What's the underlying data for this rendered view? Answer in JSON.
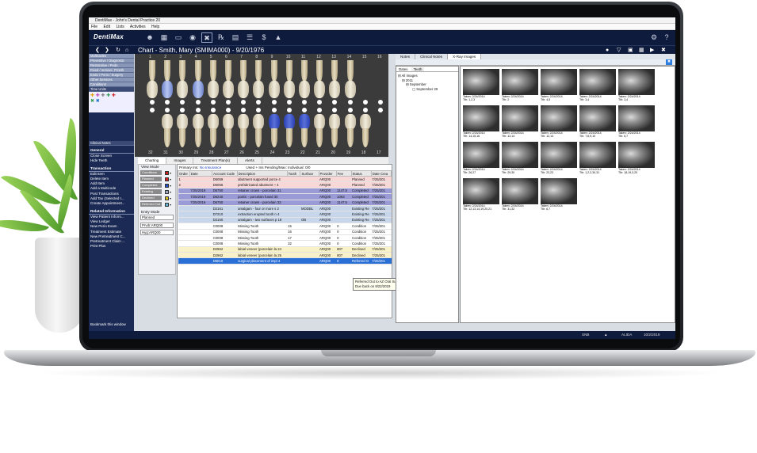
{
  "app": {
    "window_title": "DentiMax - John's Dental Practice 20",
    "logo": "DentiMax",
    "menu": [
      "File",
      "Edit",
      "Lists",
      "Activities",
      "Help"
    ],
    "chart_title": "Chart - Smith, Mary (SMIMA000) - 9/20/1976"
  },
  "sidebar": {
    "tabs": [
      "Multicodes",
      "Preventive / Diagnostic",
      "Restorative / Pedo",
      "Fixed / remove. Prosth.",
      "Endo / Perio / Surgery",
      "Other Services",
      "Conditions"
    ],
    "time_units": "Time Units",
    "clinical_notes": "Clinical Notes",
    "general_header": "General",
    "general_items": [
      "Close Screen",
      "Hide Teeth"
    ],
    "transaction_header": "Transaction",
    "transaction_items": [
      "Edit Item",
      "Delete Item",
      "Add Item",
      "Add a Multicode",
      "Post Transactions",
      "Add Tax (Selected I...",
      "Create Appointment..."
    ],
    "related_header": "Related Information",
    "related_items": [
      "View Patient Inform...",
      "View Ledger",
      "New Perio Exam",
      "Treatment Estimate",
      "New Pretreatment C...",
      "Pretreatment Claim ...",
      "Print Plus"
    ],
    "bookmark": "Bookmark this window"
  },
  "teeth": {
    "upper_numbers": [
      "1",
      "2",
      "3",
      "4",
      "5",
      "6",
      "7",
      "8",
      "9",
      "10",
      "11",
      "12",
      "13",
      "14",
      "15",
      "16"
    ],
    "lower_numbers": [
      "32",
      "31",
      "30",
      "29",
      "28",
      "27",
      "26",
      "25",
      "24",
      "23",
      "22",
      "21",
      "20",
      "19",
      "18",
      "17"
    ]
  },
  "lower_tabs": [
    "Charting",
    "Images",
    "Treatment Plan(s)",
    "Alerts"
  ],
  "view_mode": {
    "label": "View Mode",
    "buttons": [
      "Conditions",
      "Planned",
      "Completed",
      "Existing",
      "Declined",
      "Referred Out"
    ],
    "entry_mode_label": "Entry Mode",
    "entry_mode_value": "Planned",
    "provider_value": "Prvdr:ARQ00",
    "hygienist_value": "Hyg:ARQ00"
  },
  "grid": {
    "primary_ins_label": "Primary Ins:",
    "primary_ins_value": "No Insurance",
    "used_text": "Used + Ins Pending/Max: Individual: 0/0",
    "columns": [
      "Order",
      "Date",
      "Account Code",
      "Description",
      "Tooth",
      "Surface",
      "Provider",
      "Fee",
      "Status",
      "Date Crea"
    ],
    "rows": [
      {
        "order": "1",
        "date": "",
        "code": "D6059",
        "desc": "abutment supported porce 4",
        "tooth": "",
        "surface": "",
        "prov": "ARQ00",
        "fee": "",
        "status": "Planned",
        "created": "7/25/201",
        "kind": "planned"
      },
      {
        "order": "2",
        "date": "",
        "code": "D6056",
        "desc": "prefabricated abutment ~ 4",
        "tooth": "",
        "surface": "",
        "prov": "ARQ00",
        "fee": "",
        "status": "Planned",
        "created": "7/25/201",
        "kind": "planned"
      },
      {
        "order": "",
        "date": "7/25/2019",
        "code": "D6750",
        "desc": "retainer crown - porcelain 31",
        "tooth": "",
        "surface": "",
        "prov": "ARQ00",
        "fee": "1147.5",
        "status": "Completed",
        "created": "7/25/201",
        "kind": "completed"
      },
      {
        "order": "",
        "date": "7/25/2019",
        "code": "D6240",
        "desc": "pontic - porcelain fused 30",
        "tooth": "",
        "surface": "",
        "prov": "ARQ00",
        "fee": "1063",
        "status": "Completed",
        "created": "7/25/201",
        "kind": "completed"
      },
      {
        "order": "",
        "date": "7/25/2019",
        "code": "D6750",
        "desc": "retainer crown - porcelain 33",
        "tooth": "",
        "surface": "",
        "prov": "ARQ00",
        "fee": "1147.5",
        "status": "Completed",
        "created": "7/25/201",
        "kind": "completed"
      },
      {
        "order": "",
        "date": "",
        "code": "D2161",
        "desc": "amalgam - four or more s 2",
        "tooth": "",
        "surface": "MODBL",
        "prov": "ARQ00",
        "fee": "",
        "status": "Existing Re",
        "created": "7/25/201",
        "kind": "existing"
      },
      {
        "order": "",
        "date": "",
        "code": "D7210",
        "desc": "extraction erupted tooth n 4",
        "tooth": "",
        "surface": "",
        "prov": "ARQ00",
        "fee": "",
        "status": "Existing Re",
        "created": "7/25/201",
        "kind": "existing"
      },
      {
        "order": "",
        "date": "",
        "code": "D2150",
        "desc": "amalgam - two surfaces p 18",
        "tooth": "",
        "surface": "OB",
        "prov": "ARQ00",
        "fee": "",
        "status": "Existing Re",
        "created": "7/25/201",
        "kind": "existing"
      },
      {
        "order": "",
        "date": "",
        "code": "C0008",
        "desc": "Missing Tooth",
        "tooth": "15",
        "surface": "",
        "prov": "ARQ00",
        "fee": "0",
        "status": "Condition",
        "created": "7/25/201",
        "kind": "condition"
      },
      {
        "order": "",
        "date": "",
        "code": "C0008",
        "desc": "Missing Tooth",
        "tooth": "16",
        "surface": "",
        "prov": "ARQ00",
        "fee": "0",
        "status": "Condition",
        "created": "7/25/201",
        "kind": "condition"
      },
      {
        "order": "",
        "date": "",
        "code": "C0008",
        "desc": "Missing Tooth",
        "tooth": "17",
        "surface": "",
        "prov": "ARQ00",
        "fee": "0",
        "status": "Condition",
        "created": "7/25/201",
        "kind": "condition"
      },
      {
        "order": "",
        "date": "",
        "code": "C0008",
        "desc": "Missing Tooth",
        "tooth": "32",
        "surface": "",
        "prov": "ARQ00",
        "fee": "0",
        "status": "Condition",
        "created": "7/25/201",
        "kind": "condition"
      },
      {
        "order": "",
        "date": "",
        "code": "D2962",
        "desc": "labial veneer (porcelain la 24",
        "tooth": "",
        "surface": "",
        "prov": "ARQ00",
        "fee": "807",
        "status": "Declined",
        "created": "7/25/201",
        "kind": "declined"
      },
      {
        "order": "",
        "date": "",
        "code": "D2962",
        "desc": "labial veneer (porcelain la 25",
        "tooth": "",
        "surface": "",
        "prov": "ARQ00",
        "fee": "807",
        "status": "Declined",
        "created": "7/25/201",
        "kind": "declined"
      },
      {
        "order": "",
        "date": "",
        "code": "D6010",
        "desc": "surgical placement of impl 4",
        "tooth": "",
        "surface": "",
        "prov": "ARQ00",
        "fee": "0",
        "status": "Referred O",
        "created": "7/25/201",
        "kind": "selected"
      }
    ],
    "tooltip_line1": "Referred Out to AZ Oral Surgery Center",
    "tooltip_line2": "Due back on 8/22/2019"
  },
  "right_pane": {
    "tabs": [
      "Notes",
      "Clinical Notes",
      "X-Ray Images"
    ],
    "tree_tabs": [
      "Dates",
      "Teeth"
    ],
    "tree": [
      "All Images",
      "2011",
      "September",
      "September 29"
    ],
    "xrays": [
      {
        "taken": "Taken: 2/24/2014",
        "teeth": "Tth: 1,2,3"
      },
      {
        "taken": "Taken: 2/24/2014",
        "teeth": "Tth: 2"
      },
      {
        "taken": "Taken: 2/24/2014",
        "teeth": "Tth: 4,5"
      },
      {
        "taken": "Taken: 2/24/2014",
        "teeth": "Tth: 3,4"
      },
      {
        "taken": "Taken: 2/24/2014",
        "teeth": "Tth: 3,4"
      },
      {
        "taken": "Taken: 2/24/2014",
        "teeth": "Tth: 14,15,16"
      },
      {
        "taken": "Taken: 2/24/2014",
        "teeth": "Tth: 13,14"
      },
      {
        "taken": "Taken: 2/24/2014",
        "teeth": "Tth: 12,13"
      },
      {
        "taken": "Taken: 2/24/2014",
        "teeth": "Tth: 7,8,9,10"
      },
      {
        "taken": "Taken: 2/24/2014",
        "teeth": "Tth: 6,7"
      },
      {
        "taken": "Taken: 2/24/2014",
        "teeth": "Tth: 26,27"
      },
      {
        "taken": "Taken: 2/24/2014",
        "teeth": "Tth: 29,30"
      },
      {
        "taken": "Taken: 2/24/2014",
        "teeth": "Tth: 22,23"
      },
      {
        "taken": "Taken: 2/24/2014",
        "teeth": "Tth: 1,2,3,30,31"
      },
      {
        "taken": "Taken: 2/24/2014",
        "teeth": "Tth: 18,19,3,20"
      },
      {
        "taken": "Taken: 2/24/2014",
        "teeth": "Tth: 12,13,14,19,20,21"
      },
      {
        "taken": "Taken: 2/24/2014",
        "teeth": "Tth: 31,32"
      },
      {
        "taken": "Taken: 2/24/2014",
        "teeth": "Tth: 6,7"
      }
    ]
  },
  "status": {
    "user": "SNB",
    "name": "ALIDA",
    "date": "10/2/2019"
  },
  "colors": {
    "navy": "#0f1b3d",
    "planned_row": "#f8d7d7",
    "completed_row": "#9a9ad6",
    "existing_row": "#c7d6ea",
    "declined_row": "#f9f2c9",
    "selected_row": "#2a6fd6"
  }
}
